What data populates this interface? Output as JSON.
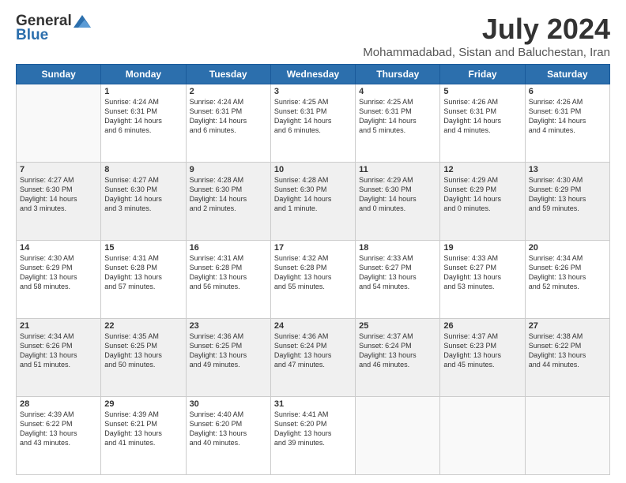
{
  "logo": {
    "general": "General",
    "blue": "Blue"
  },
  "title": "July 2024",
  "subtitle": "Mohammadabad, Sistan and Baluchestan, Iran",
  "headers": [
    "Sunday",
    "Monday",
    "Tuesday",
    "Wednesday",
    "Thursday",
    "Friday",
    "Saturday"
  ],
  "weeks": [
    [
      {
        "day": "",
        "info": ""
      },
      {
        "day": "1",
        "info": "Sunrise: 4:24 AM\nSunset: 6:31 PM\nDaylight: 14 hours\nand 6 minutes."
      },
      {
        "day": "2",
        "info": "Sunrise: 4:24 AM\nSunset: 6:31 PM\nDaylight: 14 hours\nand 6 minutes."
      },
      {
        "day": "3",
        "info": "Sunrise: 4:25 AM\nSunset: 6:31 PM\nDaylight: 14 hours\nand 6 minutes."
      },
      {
        "day": "4",
        "info": "Sunrise: 4:25 AM\nSunset: 6:31 PM\nDaylight: 14 hours\nand 5 minutes."
      },
      {
        "day": "5",
        "info": "Sunrise: 4:26 AM\nSunset: 6:31 PM\nDaylight: 14 hours\nand 4 minutes."
      },
      {
        "day": "6",
        "info": "Sunrise: 4:26 AM\nSunset: 6:31 PM\nDaylight: 14 hours\nand 4 minutes."
      }
    ],
    [
      {
        "day": "7",
        "info": "Sunrise: 4:27 AM\nSunset: 6:30 PM\nDaylight: 14 hours\nand 3 minutes."
      },
      {
        "day": "8",
        "info": "Sunrise: 4:27 AM\nSunset: 6:30 PM\nDaylight: 14 hours\nand 3 minutes."
      },
      {
        "day": "9",
        "info": "Sunrise: 4:28 AM\nSunset: 6:30 PM\nDaylight: 14 hours\nand 2 minutes."
      },
      {
        "day": "10",
        "info": "Sunrise: 4:28 AM\nSunset: 6:30 PM\nDaylight: 14 hours\nand 1 minute."
      },
      {
        "day": "11",
        "info": "Sunrise: 4:29 AM\nSunset: 6:30 PM\nDaylight: 14 hours\nand 0 minutes."
      },
      {
        "day": "12",
        "info": "Sunrise: 4:29 AM\nSunset: 6:29 PM\nDaylight: 14 hours\nand 0 minutes."
      },
      {
        "day": "13",
        "info": "Sunrise: 4:30 AM\nSunset: 6:29 PM\nDaylight: 13 hours\nand 59 minutes."
      }
    ],
    [
      {
        "day": "14",
        "info": "Sunrise: 4:30 AM\nSunset: 6:29 PM\nDaylight: 13 hours\nand 58 minutes."
      },
      {
        "day": "15",
        "info": "Sunrise: 4:31 AM\nSunset: 6:28 PM\nDaylight: 13 hours\nand 57 minutes."
      },
      {
        "day": "16",
        "info": "Sunrise: 4:31 AM\nSunset: 6:28 PM\nDaylight: 13 hours\nand 56 minutes."
      },
      {
        "day": "17",
        "info": "Sunrise: 4:32 AM\nSunset: 6:28 PM\nDaylight: 13 hours\nand 55 minutes."
      },
      {
        "day": "18",
        "info": "Sunrise: 4:33 AM\nSunset: 6:27 PM\nDaylight: 13 hours\nand 54 minutes."
      },
      {
        "day": "19",
        "info": "Sunrise: 4:33 AM\nSunset: 6:27 PM\nDaylight: 13 hours\nand 53 minutes."
      },
      {
        "day": "20",
        "info": "Sunrise: 4:34 AM\nSunset: 6:26 PM\nDaylight: 13 hours\nand 52 minutes."
      }
    ],
    [
      {
        "day": "21",
        "info": "Sunrise: 4:34 AM\nSunset: 6:26 PM\nDaylight: 13 hours\nand 51 minutes."
      },
      {
        "day": "22",
        "info": "Sunrise: 4:35 AM\nSunset: 6:25 PM\nDaylight: 13 hours\nand 50 minutes."
      },
      {
        "day": "23",
        "info": "Sunrise: 4:36 AM\nSunset: 6:25 PM\nDaylight: 13 hours\nand 49 minutes."
      },
      {
        "day": "24",
        "info": "Sunrise: 4:36 AM\nSunset: 6:24 PM\nDaylight: 13 hours\nand 47 minutes."
      },
      {
        "day": "25",
        "info": "Sunrise: 4:37 AM\nSunset: 6:24 PM\nDaylight: 13 hours\nand 46 minutes."
      },
      {
        "day": "26",
        "info": "Sunrise: 4:37 AM\nSunset: 6:23 PM\nDaylight: 13 hours\nand 45 minutes."
      },
      {
        "day": "27",
        "info": "Sunrise: 4:38 AM\nSunset: 6:22 PM\nDaylight: 13 hours\nand 44 minutes."
      }
    ],
    [
      {
        "day": "28",
        "info": "Sunrise: 4:39 AM\nSunset: 6:22 PM\nDaylight: 13 hours\nand 43 minutes."
      },
      {
        "day": "29",
        "info": "Sunrise: 4:39 AM\nSunset: 6:21 PM\nDaylight: 13 hours\nand 41 minutes."
      },
      {
        "day": "30",
        "info": "Sunrise: 4:40 AM\nSunset: 6:20 PM\nDaylight: 13 hours\nand 40 minutes."
      },
      {
        "day": "31",
        "info": "Sunrise: 4:41 AM\nSunset: 6:20 PM\nDaylight: 13 hours\nand 39 minutes."
      },
      {
        "day": "",
        "info": ""
      },
      {
        "day": "",
        "info": ""
      },
      {
        "day": "",
        "info": ""
      }
    ]
  ]
}
